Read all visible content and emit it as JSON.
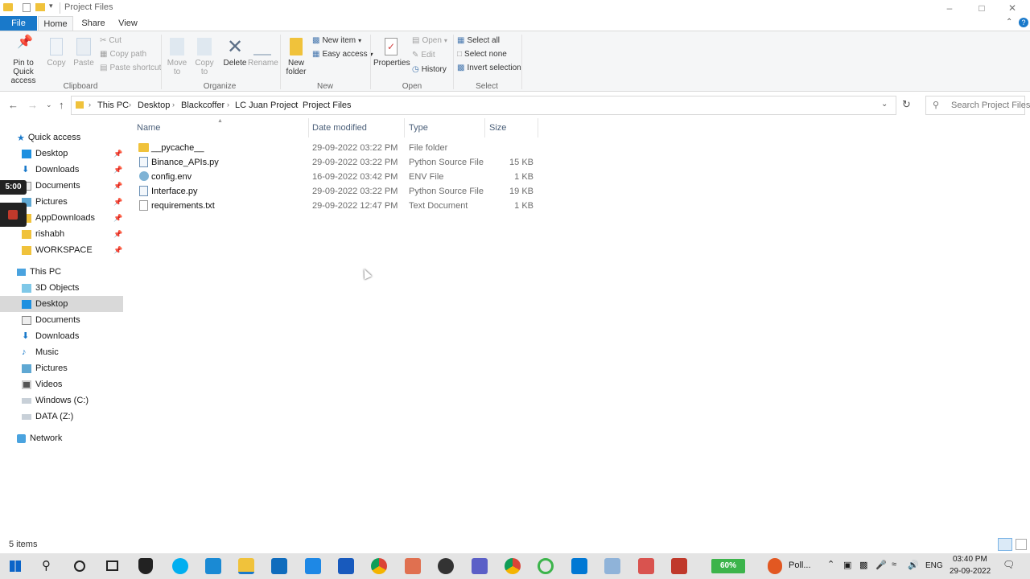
{
  "window": {
    "title": "Project Files",
    "controls": [
      "minimize-icon",
      "maximize-icon",
      "close-icon"
    ]
  },
  "ribbon_tabs": [
    "File",
    "Home",
    "Share",
    "View"
  ],
  "ribbon": {
    "clipboard": {
      "pin_to_quick_access": "Pin to Quick access",
      "copy": "Copy",
      "paste": "Paste",
      "cut": "Cut",
      "copy_path": "Copy path",
      "paste_shortcut": "Paste shortcut",
      "label": "Clipboard"
    },
    "organize": {
      "move_to": "Move to",
      "copy_to": "Copy to",
      "delete": "Delete",
      "rename": "Rename",
      "label": "Organize"
    },
    "new": {
      "new_folder": "New folder",
      "new_item": "New item",
      "easy_access": "Easy access",
      "label": "New"
    },
    "open": {
      "properties": "Properties",
      "open": "Open",
      "edit": "Edit",
      "history": "History",
      "label": "Open"
    },
    "select": {
      "select_all": "Select all",
      "select_none": "Select none",
      "invert_selection": "Invert selection",
      "label": "Select"
    }
  },
  "address": {
    "breadcrumbs": [
      "This PC",
      "Desktop",
      "Blackcoffer",
      "LC Juan Project",
      "Project Files"
    ],
    "search_placeholder": "Search Project Files"
  },
  "nav": {
    "quick_access": "Quick access",
    "quick_items": [
      "Desktop",
      "Downloads",
      "Documents",
      "Pictures",
      "AppDownloads",
      "rishabh",
      "WORKSPACE"
    ],
    "this_pc": "This PC",
    "pc_items": [
      "3D Objects",
      "Desktop",
      "Documents",
      "Downloads",
      "Music",
      "Pictures",
      "Videos",
      "Windows (C:)",
      "DATA (Z:)"
    ],
    "network": "Network"
  },
  "columns": [
    "Name",
    "Date modified",
    "Type",
    "Size"
  ],
  "files": [
    {
      "name": "__pycache__",
      "date": "29-09-2022 03:22 PM",
      "type": "File folder",
      "size": ""
    },
    {
      "name": "Binance_APIs.py",
      "date": "29-09-2022 03:22 PM",
      "type": "Python Source File",
      "size": "15 KB"
    },
    {
      "name": "config.env",
      "date": "16-09-2022 03:42 PM",
      "type": "ENV File",
      "size": "1 KB"
    },
    {
      "name": "Interface.py",
      "date": "29-09-2022 03:22 PM",
      "type": "Python Source File",
      "size": "19 KB"
    },
    {
      "name": "requirements.txt",
      "date": "29-09-2022 12:47 PM",
      "type": "Text Document",
      "size": "1 KB"
    }
  ],
  "status": {
    "items": "5 items"
  },
  "recorder": {
    "time": "5:00"
  },
  "taskbar": {
    "battery": "60%",
    "app_label": "Poll...",
    "lang": "ENG",
    "time": "03:40 PM",
    "date": "29-09-2022"
  },
  "colors": {
    "accent": "#1979ca",
    "folder": "#f0c23b",
    "selected": "#d9d9d9"
  }
}
